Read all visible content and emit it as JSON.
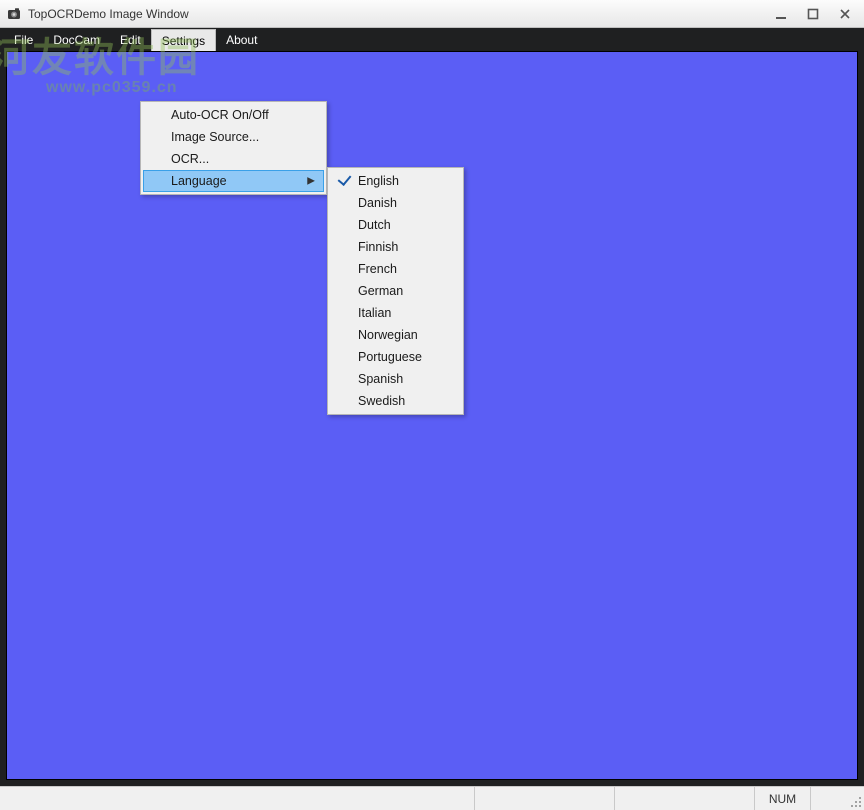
{
  "window": {
    "title": "TopOCRDemo Image Window"
  },
  "menubar": {
    "items": [
      "File",
      "DocCam",
      "Edit",
      "Settings",
      "About"
    ],
    "active_index": 3
  },
  "settings_menu": {
    "items": [
      {
        "label": "Auto-OCR On/Off",
        "has_sub": false
      },
      {
        "label": "Image Source...",
        "has_sub": false
      },
      {
        "label": "OCR...",
        "has_sub": false
      },
      {
        "label": "Language",
        "has_sub": true,
        "hot": true
      }
    ]
  },
  "language_menu": {
    "items": [
      {
        "label": "English",
        "checked": true
      },
      {
        "label": "Danish"
      },
      {
        "label": "Dutch"
      },
      {
        "label": "Finnish"
      },
      {
        "label": "French"
      },
      {
        "label": "German"
      },
      {
        "label": "Italian"
      },
      {
        "label": "Norwegian"
      },
      {
        "label": "Portuguese"
      },
      {
        "label": "Spanish"
      },
      {
        "label": "Swedish"
      }
    ]
  },
  "statusbar": {
    "num_label": "NUM"
  },
  "watermark": {
    "line1": "河友软件园",
    "line2": "www.pc0359.cn"
  }
}
